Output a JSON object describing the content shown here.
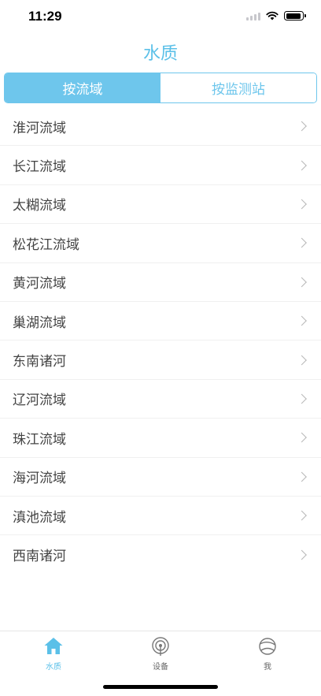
{
  "status_bar": {
    "time": "11:29",
    "battery_level": 0.9
  },
  "header": {
    "title": "水质"
  },
  "segmented": {
    "options": [
      {
        "label": "按流域",
        "selected": true
      },
      {
        "label": "按监测站",
        "selected": false
      }
    ]
  },
  "list": {
    "items": [
      {
        "label": "淮河流域"
      },
      {
        "label": "长江流域"
      },
      {
        "label": "太糊流域"
      },
      {
        "label": "松花江流域"
      },
      {
        "label": "黄河流域"
      },
      {
        "label": "巢湖流域"
      },
      {
        "label": "东南诸河"
      },
      {
        "label": "辽河流域"
      },
      {
        "label": "珠江流域"
      },
      {
        "label": "海河流域"
      },
      {
        "label": "滇池流域"
      },
      {
        "label": "西南诸河"
      }
    ]
  },
  "tab_bar": {
    "tabs": [
      {
        "label": "水质",
        "icon": "home-icon",
        "active": true
      },
      {
        "label": "设备",
        "icon": "device-icon",
        "active": false
      },
      {
        "label": "我",
        "icon": "profile-icon",
        "active": false
      }
    ]
  },
  "colors": {
    "accent": "#6ec6ec",
    "title": "#5bc0e8"
  }
}
